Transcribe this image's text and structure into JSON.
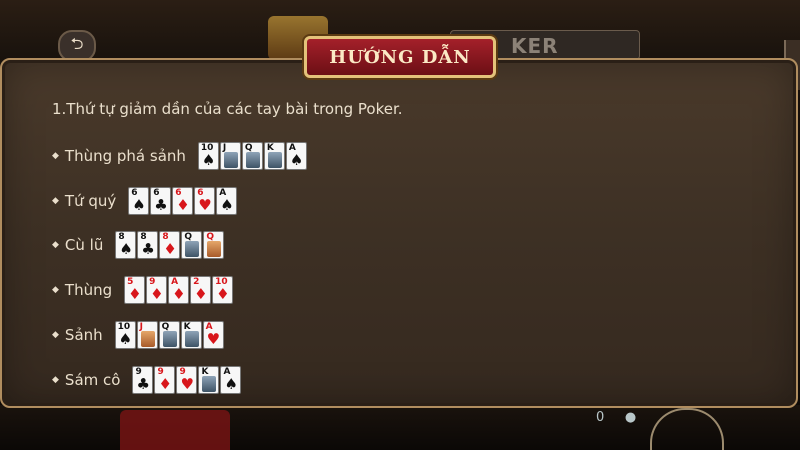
{
  "background": {
    "game_title": "KER",
    "back_icon": "back-arrow-icon"
  },
  "dialog": {
    "title": "HƯỚNG DẪN",
    "intro": "1.Thứ tự giảm dần của các tay bài trong Poker.",
    "hands": [
      {
        "label": "Thùng phá sảnh",
        "cards": [
          {
            "rank": "10",
            "suit": "♠",
            "color": "black",
            "face": false
          },
          {
            "rank": "J",
            "suit": "♠",
            "color": "black",
            "face": true
          },
          {
            "rank": "Q",
            "suit": "♠",
            "color": "black",
            "face": true
          },
          {
            "rank": "K",
            "suit": "♠",
            "color": "black",
            "face": true
          },
          {
            "rank": "A",
            "suit": "♠",
            "color": "black",
            "face": false
          }
        ]
      },
      {
        "label": "Tứ quý",
        "cards": [
          {
            "rank": "6",
            "suit": "♠",
            "color": "black",
            "face": false
          },
          {
            "rank": "6",
            "suit": "♣",
            "color": "black",
            "face": false
          },
          {
            "rank": "6",
            "suit": "♦",
            "color": "red",
            "face": false
          },
          {
            "rank": "6",
            "suit": "♥",
            "color": "red",
            "face": false
          },
          {
            "rank": "A",
            "suit": "♠",
            "color": "black",
            "face": false
          }
        ]
      },
      {
        "label": "Cù lũ",
        "cards": [
          {
            "rank": "8",
            "suit": "♠",
            "color": "black",
            "face": false
          },
          {
            "rank": "8",
            "suit": "♣",
            "color": "black",
            "face": false
          },
          {
            "rank": "8",
            "suit": "♦",
            "color": "red",
            "face": false
          },
          {
            "rank": "Q",
            "suit": "♣",
            "color": "black",
            "face": true
          },
          {
            "rank": "Q",
            "suit": "♦",
            "color": "red",
            "face": true
          }
        ]
      },
      {
        "label": "Thùng",
        "cards": [
          {
            "rank": "5",
            "suit": "♦",
            "color": "red",
            "face": false
          },
          {
            "rank": "9",
            "suit": "♦",
            "color": "red",
            "face": false
          },
          {
            "rank": "A",
            "suit": "♦",
            "color": "red",
            "face": false
          },
          {
            "rank": "2",
            "suit": "♦",
            "color": "red",
            "face": false
          },
          {
            "rank": "10",
            "suit": "♦",
            "color": "red",
            "face": false
          }
        ]
      },
      {
        "label": "Sảnh",
        "cards": [
          {
            "rank": "10",
            "suit": "♠",
            "color": "black",
            "face": false
          },
          {
            "rank": "J",
            "suit": "♦",
            "color": "red",
            "face": true
          },
          {
            "rank": "Q",
            "suit": "♣",
            "color": "black",
            "face": true
          },
          {
            "rank": "K",
            "suit": "♣",
            "color": "black",
            "face": true
          },
          {
            "rank": "A",
            "suit": "♥",
            "color": "red",
            "face": false
          }
        ]
      },
      {
        "label": "Sám cô",
        "cards": [
          {
            "rank": "9",
            "suit": "♣",
            "color": "black",
            "face": false
          },
          {
            "rank": "9",
            "suit": "♦",
            "color": "red",
            "face": false
          },
          {
            "rank": "9",
            "suit": "♥",
            "color": "red",
            "face": false
          },
          {
            "rank": "K",
            "suit": "♣",
            "color": "black",
            "face": true
          },
          {
            "rank": "A",
            "suit": "♠",
            "color": "black",
            "face": false
          }
        ]
      }
    ]
  },
  "colors": {
    "accent_red": "#a4202a",
    "gold_border": "#e4c27a",
    "text": "#eadfcc"
  }
}
